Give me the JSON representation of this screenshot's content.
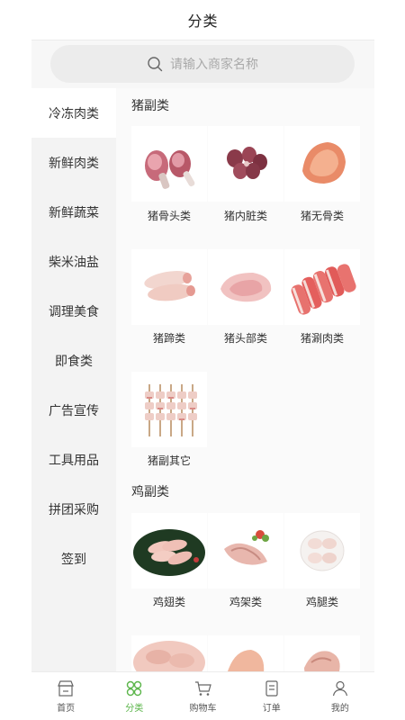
{
  "header": {
    "title": "分类"
  },
  "search": {
    "placeholder": "请输入商家名称",
    "icon": "search-icon"
  },
  "sidebar": {
    "items": [
      {
        "label": "冷冻肉类",
        "active": true
      },
      {
        "label": "新鲜肉类"
      },
      {
        "label": "新鲜蔬菜"
      },
      {
        "label": "柴米油盐"
      },
      {
        "label": "调理美食"
      },
      {
        "label": "即食类"
      },
      {
        "label": "广告宣传"
      },
      {
        "label": "工具用品"
      },
      {
        "label": "拼团采购"
      },
      {
        "label": "签到"
      }
    ]
  },
  "sections": [
    {
      "title": "猪副类",
      "items": [
        {
          "label": "猪骨头类"
        },
        {
          "label": "猪内脏类"
        },
        {
          "label": "猪无骨类"
        },
        {
          "label": "猪蹄类"
        },
        {
          "label": "猪头部类"
        },
        {
          "label": "猪涮肉类"
        },
        {
          "label": "猪副其它"
        }
      ]
    },
    {
      "title": "鸡副类",
      "items": [
        {
          "label": "鸡翅类"
        },
        {
          "label": "鸡架类"
        },
        {
          "label": "鸡腿类"
        }
      ]
    }
  ],
  "tabbar": {
    "items": [
      {
        "label": "首页",
        "icon": "home-icon"
      },
      {
        "label": "分类",
        "icon": "category-icon",
        "active": true
      },
      {
        "label": "购物车",
        "icon": "cart-icon"
      },
      {
        "label": "订单",
        "icon": "order-icon"
      },
      {
        "label": "我的",
        "icon": "profile-icon"
      }
    ]
  },
  "colors": {
    "accent": "#5bb54a",
    "active_bg": "#ffffff",
    "sidebar_bg": "#f3f3f3"
  }
}
